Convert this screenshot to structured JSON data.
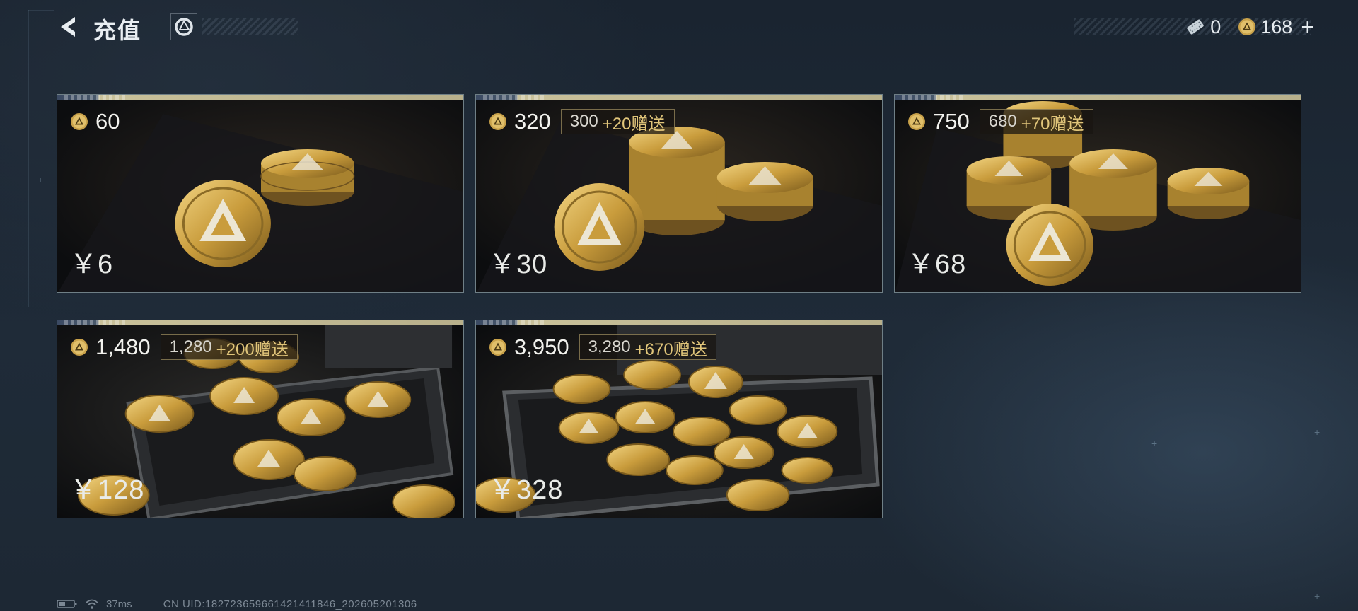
{
  "header": {
    "title": "充值",
    "back_icon": "back-arrow-icon",
    "logo_icon": "game-logo-icon"
  },
  "currencies": [
    {
      "icon": "ticket-icon",
      "value": "0"
    },
    {
      "icon": "coin-icon",
      "value": "168"
    }
  ],
  "add_label": "+",
  "packages": [
    {
      "amount": "60",
      "base": "",
      "bonus": "",
      "price": "￥6"
    },
    {
      "amount": "320",
      "base": "300",
      "bonus": "+20赠送",
      "price": "￥30"
    },
    {
      "amount": "750",
      "base": "680",
      "bonus": "+70赠送",
      "price": "￥68"
    },
    {
      "amount": "1,480",
      "base": "1,280",
      "bonus": "+200赠送",
      "price": "￥128"
    },
    {
      "amount": "3,950",
      "base": "3,280",
      "bonus": "+670赠送",
      "price": "￥328"
    }
  ],
  "footer": {
    "battery_icon": "battery-icon",
    "wifi_icon": "wifi-icon",
    "ping": "37ms",
    "uid": "CN UID:18272365966142141​1846_202605201306"
  },
  "colors": {
    "background": "#1c2733",
    "card_border": "#6f7f86",
    "bonus_text": "#e0c57a",
    "gold": "#c9a24a"
  }
}
